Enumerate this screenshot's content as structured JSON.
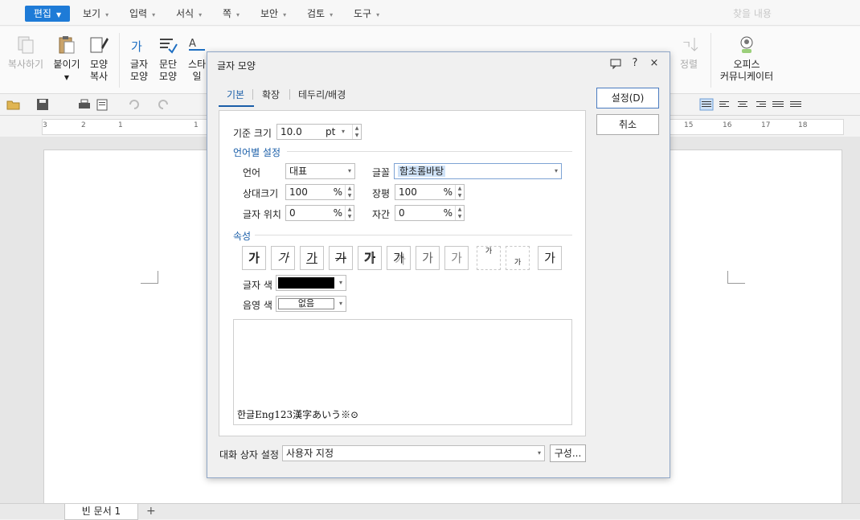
{
  "menubar": {
    "items": [
      "편집",
      "보기",
      "입력",
      "서식",
      "쪽",
      "보안",
      "검토",
      "도구"
    ],
    "find_placeholder": "찾을 내용"
  },
  "ribbon": {
    "copy": "복사하기",
    "paste": "붙이기",
    "shape_copy_1": "모양",
    "shape_copy_2": "복사",
    "char_shape_1": "글자",
    "char_shape_2": "모양",
    "para_shape_1": "문단",
    "para_shape_2": "모양",
    "style": "스타일",
    "sort": "정렬",
    "office_comm_1": "오피스",
    "office_comm_2": "커뮤니케이터"
  },
  "ruler": {
    "ticks": [
      "3",
      "2",
      "1",
      "1",
      "15",
      "16",
      "17",
      "18"
    ]
  },
  "doc_tab": "빈 문서 1",
  "dialog": {
    "title": "글자 모양",
    "help": "?",
    "close": "×",
    "tabs": [
      "기본",
      "확장",
      "테두리/배경"
    ],
    "base_size_label": "기준 크기",
    "base_size_value": "10.0",
    "base_size_unit": "pt",
    "lang_section": "언어별 설정",
    "lang_label": "언어",
    "lang_value": "대표",
    "font_label": "글꼴",
    "font_value": "함초롬바탕",
    "rel_size_label": "상대크기",
    "rel_size_value": "100",
    "width_label": "장평",
    "width_value": "100",
    "pos_label": "글자 위치",
    "pos_value": "0",
    "spacing_label": "자간",
    "spacing_value": "0",
    "percent": "%",
    "attr_section": "속성",
    "attr_glyph": "가",
    "text_color_label": "글자 색",
    "text_color": "#000000",
    "shade_color_label": "음영 색",
    "shade_color_value": "없음",
    "preview_text": "한글Eng123漢字あいう※⊙",
    "ok": "설정(D)",
    "cancel": "취소",
    "dialog_setting_label": "대화 상자 설정",
    "dialog_setting_value": "사용자 지정",
    "configure": "구성..."
  },
  "colors": {
    "accent": "#1e7bd7",
    "section": "#1a5ea8"
  }
}
